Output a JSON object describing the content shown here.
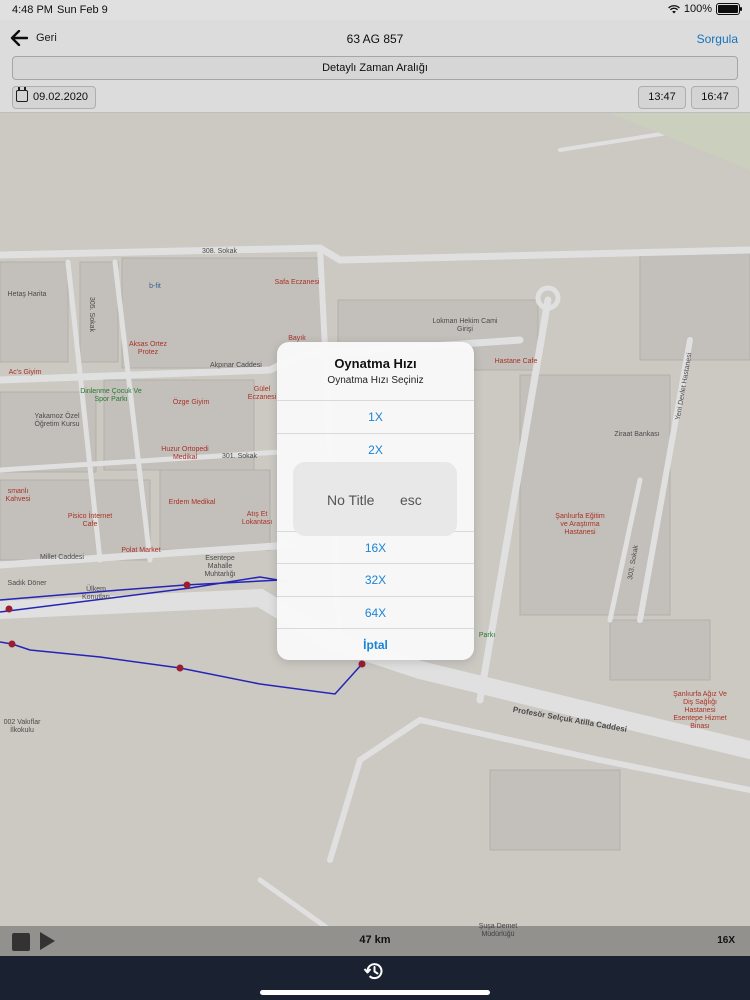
{
  "status": {
    "time": "4:48 PM",
    "date": "Sun Feb 9",
    "battery": "100%"
  },
  "header": {
    "back_label": "Geri",
    "title": "63 AG 857",
    "query_label": "Sorgula",
    "range_label": "Detaylı Zaman Aralığı",
    "date_value": "09.02.2020",
    "time_start": "13:47",
    "time_end": "16:47"
  },
  "map": {
    "pois": [
      "Hetaş Harita",
      "b-fit",
      "Safa Eczanesi",
      "Aksas Ortez Protez",
      "Bayık",
      "Lokman Hekim Cami Girişi",
      "Hastane Cafe",
      "Ac's Giyim",
      "Dinlenme Çocuk Ve Spor Parkı",
      "Özge Giyim",
      "Gülel Eczanesi",
      "Ziraat Bankası",
      "Yakamoz Özel Öğretim Kursu",
      "Huzur Ortopedi Medikal",
      "smanlı Kahvesi",
      "Erdem Medikal",
      "Atış Et Lokantası",
      "Şanlıurfa Eğitim ve Araştırma Hastanesi",
      "Pisico İnternet Cafe",
      "Polat Market",
      "Esentepe Mahalle Muhtarlığı",
      "Sadık Döner",
      "Ülkem Konutları",
      "Parkı",
      "Şanlıurfa Ağız Ve Diş Sağlığı Hastanesi Esentepe Hizmet Binası",
      "002 Vakıflar İlkokulu",
      "Şuşa Demet Müdürlüğü"
    ],
    "streets": [
      "308. Sokak",
      "305. Sokak",
      "Akpınar Caddesi",
      "301. Sokak",
      "Millet Caddesi",
      "Profesör Selçuk Atilla Caddesi",
      "303. Sokak",
      "Yeni Devlet Hastanesi"
    ],
    "route_color": "#2a2ad0",
    "stop_color": "#b0233a"
  },
  "dialog": {
    "title": "Oynatma Hızı",
    "subtitle": "Oynatma Hızı Seçiniz",
    "options": [
      "1X",
      "2X",
      "16X",
      "32X",
      "64X"
    ],
    "cancel": "İptal",
    "hud_left": "No Title",
    "hud_right": "esc"
  },
  "player": {
    "distance": "47 km",
    "speed": "16X"
  },
  "colors": {
    "accent": "#1a84d6",
    "tabbar": "#1a2231"
  },
  "icons": [
    "back-arrow-icon",
    "wifi-icon",
    "battery-icon",
    "calendar-icon",
    "stop-icon",
    "play-icon",
    "history-icon"
  ]
}
